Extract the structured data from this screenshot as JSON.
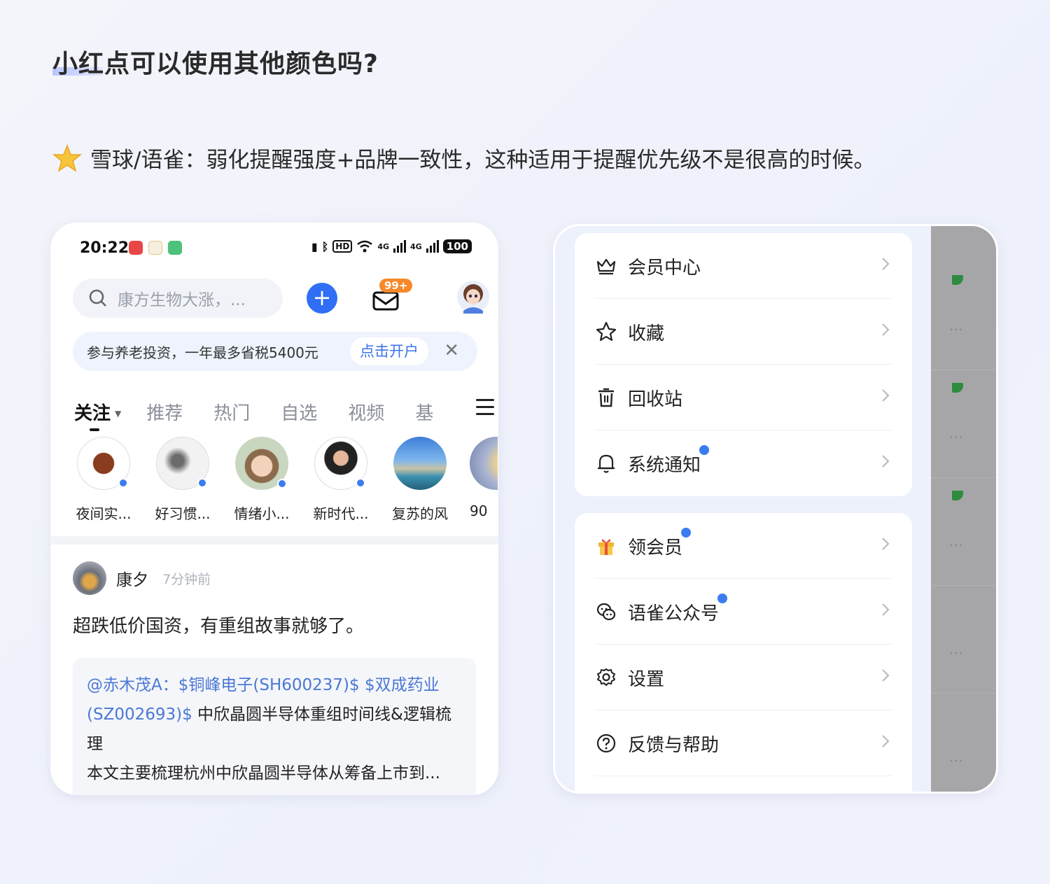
{
  "page": {
    "title": "小红点可以使用其他颜色吗?",
    "note": "雪球/语雀：弱化提醒强度+品牌一致性，这种适用于提醒优先级不是很高的时候。"
  },
  "left_phone": {
    "status": {
      "time": "20:22",
      "network": "4G",
      "battery": "100"
    },
    "search": {
      "placeholder": "康方生物大涨，..."
    },
    "mail_badge": "99+",
    "promo": {
      "text": "参与养老投资，一年最多省税5400元",
      "cta": "点击开户"
    },
    "tabs": [
      {
        "label": "关注",
        "active": true
      },
      {
        "label": "推荐"
      },
      {
        "label": "热门"
      },
      {
        "label": "自选"
      },
      {
        "label": "视频"
      },
      {
        "label": "基"
      }
    ],
    "follows": [
      {
        "name": "夜间实..."
      },
      {
        "name": "好习惯..."
      },
      {
        "name": "情绪小..."
      },
      {
        "name": "新时代..."
      },
      {
        "name": "复苏的风"
      },
      {
        "name": "90"
      }
    ],
    "post": {
      "author": "康夕",
      "time": "7分钟前",
      "body": "超跌低价国资，有重组故事就够了。",
      "quote": {
        "line1_link": "@赤木茂A：$铜峰电子(SH600237)$ $双成药业",
        "line2_link": "(SZ002693)$",
        "line2_text": " 中欣晶圆半导体重组时间线&逻辑梳",
        "line3": "理",
        "line4": "本文主要梳理杭州中欣晶圆半导体从筹备上市到..."
      }
    },
    "colors": {
      "accent_blue": "#2f6ef5",
      "badge_orange": "#f7892a",
      "dot_blue": "#3b7cf0"
    }
  },
  "right_phone": {
    "group1": [
      {
        "label": "会员中心",
        "icon": "crown-icon",
        "dot": false
      },
      {
        "label": "收藏",
        "icon": "star-icon",
        "dot": false
      },
      {
        "label": "回收站",
        "icon": "trash-icon",
        "dot": false
      },
      {
        "label": "系统通知",
        "icon": "bell-icon",
        "dot": true
      }
    ],
    "group2": [
      {
        "label": "领会员",
        "icon": "gift-icon",
        "dot": true
      },
      {
        "label": "语雀公众号",
        "icon": "wechat-icon",
        "dot": true
      },
      {
        "label": "设置",
        "icon": "gear-icon",
        "dot": false
      },
      {
        "label": "反馈与帮助",
        "icon": "help-icon",
        "dot": false
      }
    ],
    "colors": {
      "dot_blue": "#3b7cf0",
      "overlay_gray": "#a6a6a8",
      "flag_green": "#2e8b3f"
    }
  }
}
